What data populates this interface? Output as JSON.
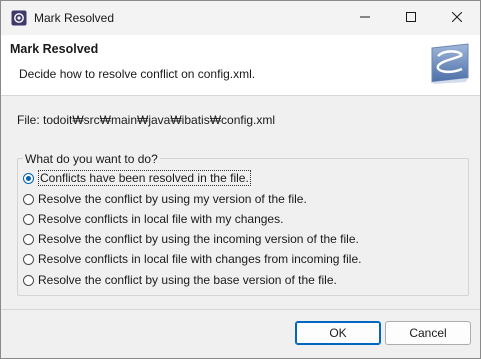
{
  "window": {
    "title": "Mark Resolved",
    "app_icon": "eclipse-window-icon",
    "minimize_icon": "minimize-icon",
    "maximize_icon": "maximize-icon",
    "close_icon": "close-icon"
  },
  "banner": {
    "title": "Mark Resolved",
    "description": "Decide how to resolve conflict on config.xml.",
    "logo_icon": "subversive-logo"
  },
  "file_path": "File: todoit₩src₩main₩java₩ibatis₩config.xml",
  "group": {
    "title": "What do you want to do?",
    "selected_index": 0,
    "options": [
      "Conflicts have been resolved in the file.",
      "Resolve the conflict by using my version of the file.",
      "Resolve conflicts in local file with my changes.",
      "Resolve the conflict by using the incoming version of the file.",
      "Resolve conflicts in local file with changes from incoming file.",
      "Resolve the conflict by using the base version of the file."
    ]
  },
  "buttons": {
    "ok": "OK",
    "cancel": "Cancel"
  },
  "colors": {
    "accent": "#0063b1",
    "banner_bg": "#ffffff",
    "dialog_bg": "#f0f0f0"
  }
}
